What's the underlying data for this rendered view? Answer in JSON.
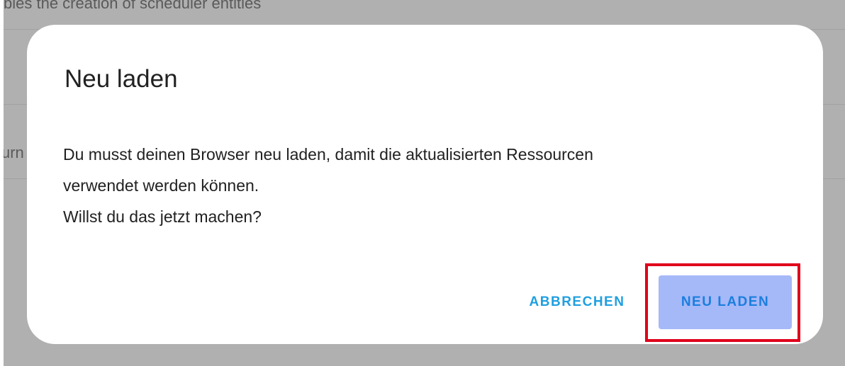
{
  "background": {
    "top_text": "bles the creation of scheduler entities",
    "mid_text": "urn"
  },
  "dialog": {
    "title": "Neu laden",
    "message_lines": [
      "Du musst deinen Browser neu laden, damit die aktualisierten Ressourcen",
      "verwendet werden können.",
      "Willst du das jetzt machen?"
    ],
    "cancel_label": "ABBRECHEN",
    "confirm_label": "NEU LADEN"
  },
  "colors": {
    "accent": "#1f9fe0",
    "highlight_border": "#e0001c",
    "confirm_button_bg": "#a5b8f8"
  }
}
